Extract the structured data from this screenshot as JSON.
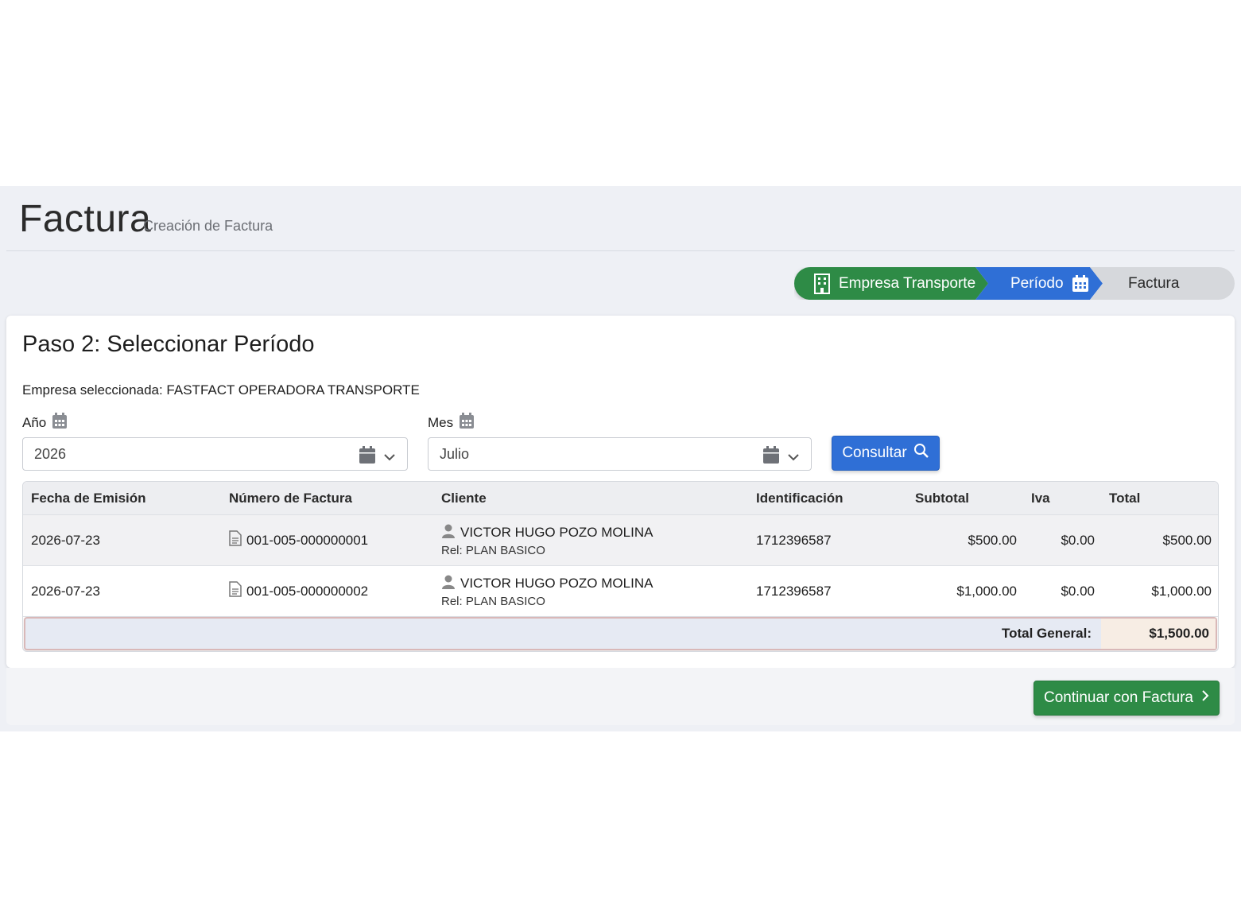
{
  "header": {
    "title": "Factura",
    "subtitle": "Creación de Factura"
  },
  "stepper": {
    "steps": [
      {
        "label": "Empresa Transporte",
        "icon": "building-icon",
        "state": "completed",
        "color": "#2e8b46"
      },
      {
        "label": "Período",
        "icon": "calendar-icon",
        "state": "active",
        "color": "#2f6fd6"
      },
      {
        "label": "Factura",
        "state": "pending",
        "color": "#d6d8dc"
      }
    ]
  },
  "card": {
    "title": "Paso 2: Seleccionar Período",
    "empresa_text": "Empresa seleccionada: FASTFACT OPERADORA TRANSPORTE"
  },
  "filters": {
    "year": {
      "label": "Año",
      "value": "2026"
    },
    "month": {
      "label": "Mes",
      "value": "Julio"
    },
    "consultar_label": "Consultar"
  },
  "table": {
    "columns": [
      "Fecha de Emisión",
      "Número de Factura",
      "Cliente",
      "Identificación",
      "Subtotal",
      "Iva",
      "Total"
    ],
    "rows": [
      {
        "fecha": "2026-07-23",
        "numero": "001-005-000000001",
        "cliente": "VICTOR HUGO POZO MOLINA",
        "rel": "Rel: PLAN BASICO",
        "identificacion": "1712396587",
        "subtotal": "$500.00",
        "iva": "$0.00",
        "total": "$500.00"
      },
      {
        "fecha": "2026-07-23",
        "numero": "001-005-000000002",
        "cliente": "VICTOR HUGO POZO MOLINA",
        "rel": "Rel: PLAN BASICO",
        "identificacion": "1712396587",
        "subtotal": "$1,000.00",
        "iva": "$0.00",
        "total": "$1,000.00"
      }
    ],
    "total_label": "Total General:",
    "total_value": "$1,500.00"
  },
  "footer": {
    "continuar_label": "Continuar con Factura"
  }
}
